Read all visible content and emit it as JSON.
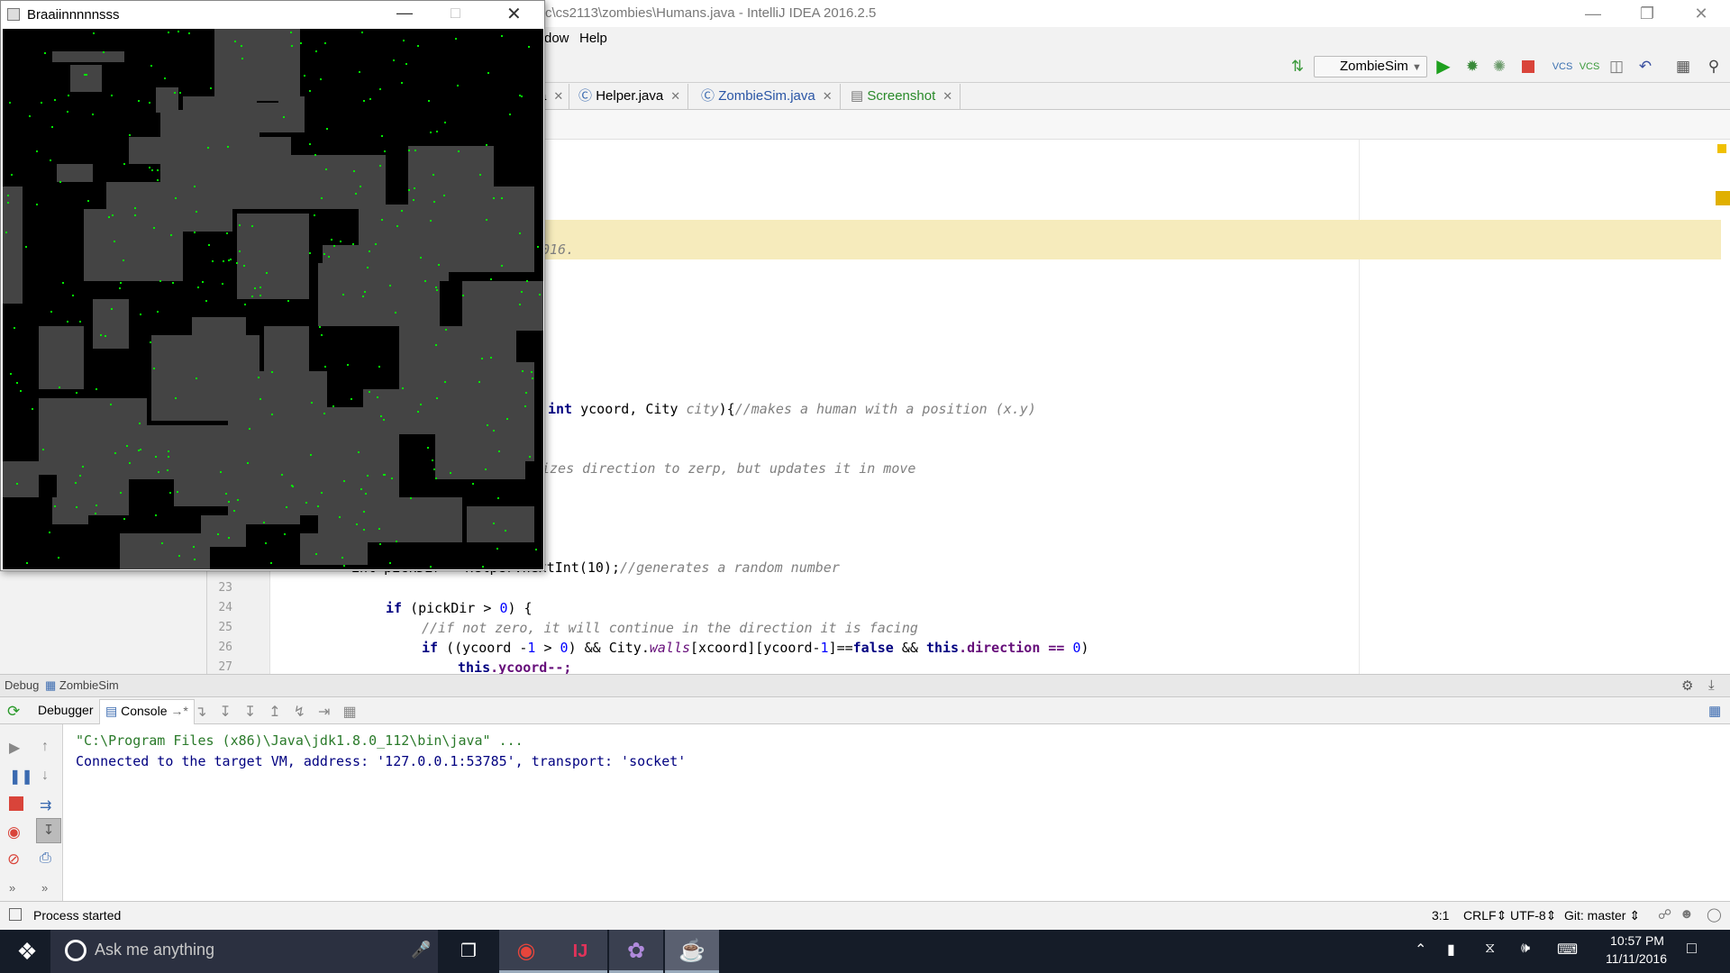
{
  "ide": {
    "title": "rc\\cs2113\\zombies\\Humans.java - IntelliJ IDEA 2016.2.5",
    "menu": {
      "partial": "dow",
      "help": "Help"
    },
    "run_config": "ZombieSim",
    "tabs": [
      {
        "label": "a",
        "icon": "java-class-icon"
      },
      {
        "label": "Helper.java",
        "icon": "java-class-icon"
      },
      {
        "label": "ZombieSim.java",
        "icon": "java-class-icon"
      },
      {
        "label": "Screenshot",
        "icon": "file-icon"
      }
    ],
    "code": {
      "c1": "016.",
      "c2_kw": "int",
      "c2_a": " ycoord, City ",
      "c2_b": "city",
      "c2_c": "){",
      "c2_cm": "//makes a human with a position (x.y)",
      "c3_cm": "izes direction to zerp, but updates it in move",
      "c4": "int pickDir = Helper.nextInt(10);",
      "c4_cm": "//generates a random number",
      "c5_kw": "if",
      "c5": " (pickDir > ",
      "c5_num": "0",
      "c5_end": ") {",
      "c6_cm": "//if not zero, it will continue in the direction it is facing",
      "c7_kw": "if",
      "c7_a": " ((ycoord -",
      "c7_n1": "1",
      "c7_b": " > ",
      "c7_n2": "0",
      "c7_c": ") && City.",
      "c7_fd": "walls",
      "c7_d": "[xcoord][ycoord-",
      "c7_n3": "1",
      "c7_e": "]==",
      "c7_kw2": "false",
      "c7_f": " && ",
      "c7_kw3": "this",
      "c7_g": ".direction == ",
      "c7_n4": "0",
      "c7_h": ")",
      "c8_kw": "this",
      "c8": ".ycoord--;",
      "line_numbers": [
        "23",
        "24",
        "25",
        "26",
        "27"
      ]
    },
    "debug": {
      "label": "Debug",
      "config": "ZombieSim",
      "tab_debugger": "Debugger",
      "tab_console": "Console",
      "console_lines": [
        "\"C:\\Program Files (x86)\\Java\\jdk1.8.0_112\\bin\\java\" ...",
        "Connected to the target VM, address: '127.0.0.1:53785', transport: 'socket'"
      ]
    },
    "status": {
      "message": "Process started",
      "position": "3:1",
      "line_sep": "CRLF",
      "encoding": "UTF-8",
      "git": "Git: master"
    }
  },
  "sim_window": {
    "title": "Braaiinnnnnsss"
  },
  "taskbar": {
    "search_placeholder": "Ask me anything",
    "time": "10:57 PM",
    "date": "11/11/2016"
  },
  "colors": {
    "wall": "#444444",
    "ground": "#000000",
    "human": "#00ee00",
    "highlight": "#f6ebbc"
  }
}
